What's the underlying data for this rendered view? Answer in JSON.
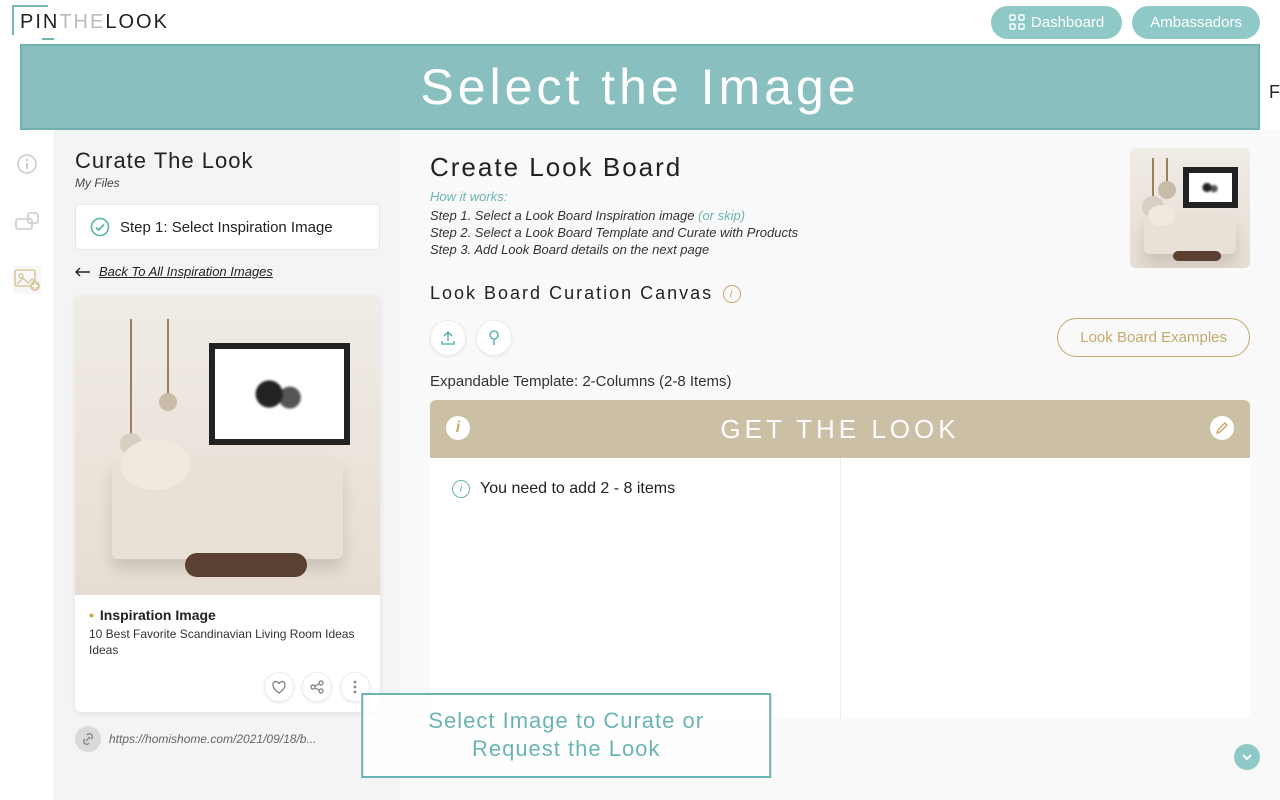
{
  "brand": {
    "pin": "PIN",
    "the": "THE",
    "look": "LOOK"
  },
  "nav": {
    "dashboard": "Dashboard",
    "ambassadors": "Ambassadors"
  },
  "banner": {
    "title": "Select the Image"
  },
  "rightClip": "F",
  "sidebar": {
    "title": "Curate The Look",
    "subtitle": "My Files",
    "step1": "Step 1: Select Inspiration Image",
    "back": "Back To All Inspiration Images",
    "card": {
      "tag": "Inspiration Image",
      "desc": "10 Best Favorite Scandinavian Living Room Ideas Ideas"
    },
    "sourceUrl": "https://homishome.com/2021/09/18/b..."
  },
  "main": {
    "title": "Create Look Board",
    "howItWorks": "How it works:",
    "step1a": "Step 1. Select a Look Board Inspiration image ",
    "step1skip": "(or skip)",
    "step2": "Step 2. Select a Look Board Template and Curate with Products",
    "step3": "Step 3. Add Look Board details on the next page",
    "canvasTitle": "Look Board Curation Canvas",
    "examples": "Look Board Examples",
    "templateLabel": "Expandable Template: 2-Columns (2-8 Items)",
    "getTheLook": "GET THE LOOK",
    "needItems": "You need to add 2 - 8 items"
  },
  "cta": {
    "line1": "Select Image to Curate or",
    "line2": "Request the Look"
  }
}
